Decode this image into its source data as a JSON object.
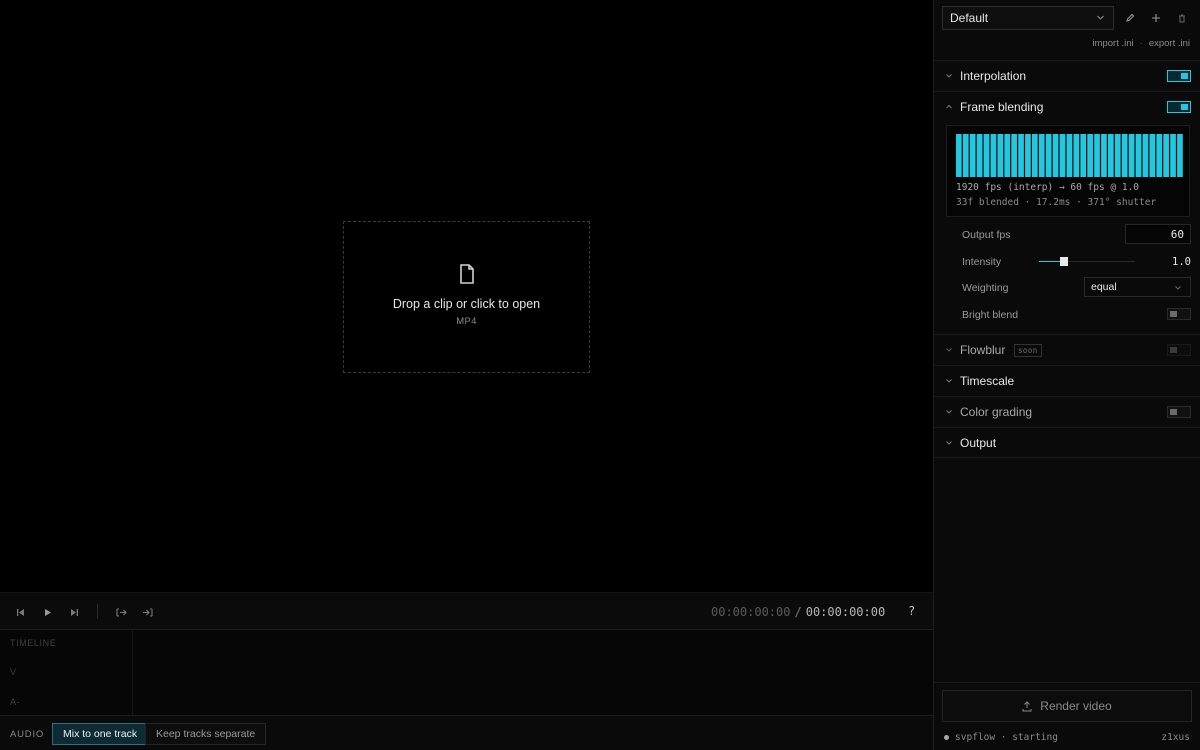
{
  "viewer": {
    "drop_title": "Drop a clip or click to open",
    "drop_subtitle": "MP4"
  },
  "transport": {
    "current_time": "00:00:00:00",
    "separator": "/",
    "total_time": "00:00:00:00",
    "help_label": "?"
  },
  "timeline": {
    "heading": "TIMELINE",
    "video_track": "V",
    "audio_track": "A-"
  },
  "audio": {
    "label": "AUDIO",
    "options": [
      "Mix to one track",
      "Keep tracks separate"
    ],
    "selected": "Mix to one track"
  },
  "panel": {
    "preset": "Default",
    "import_label": "import .ini",
    "link_separator": "·",
    "export_label": "export .ini",
    "sections": {
      "interpolation": {
        "title": "Interpolation",
        "enabled": true
      },
      "frame_blending": {
        "title": "Frame blending",
        "enabled": true,
        "summary_line1": "1920 fps (interp) → 60 fps @ 1.0",
        "summary_line2": "33f blended · 17.2ms · 371° shutter",
        "blended_frames": 33,
        "output_fps_label": "Output fps",
        "output_fps": "60",
        "intensity_label": "Intensity",
        "intensity_value": "1.0",
        "intensity_fraction": 0.26,
        "weighting_label": "Weighting",
        "weighting_value": "equal",
        "bright_blend_label": "Bright blend",
        "bright_blend": false
      },
      "flowblur": {
        "title": "Flowblur",
        "badge": "soon",
        "enabled": false
      },
      "timescale": {
        "title": "Timescale"
      },
      "color_grading": {
        "title": "Color grading",
        "enabled": false
      },
      "output": {
        "title": "Output"
      }
    },
    "render_label": "Render video",
    "status_text": "svpflow · starting",
    "user": "z1xus"
  },
  "colors": {
    "accent": "#22c7e0",
    "background": "#000000",
    "panel": "#0a0a0a"
  }
}
